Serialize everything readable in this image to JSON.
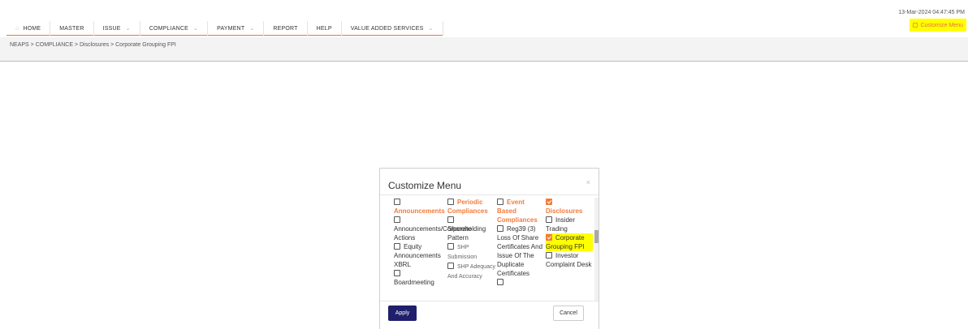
{
  "header": {
    "timestamp": "13-Mar-2024 04:47:45 PM",
    "customize_label": "Customize Menu"
  },
  "nav": {
    "items": [
      {
        "label": "HOME"
      },
      {
        "label": "MASTER"
      },
      {
        "label": "ISSUE"
      },
      {
        "label": "COMPLIANCE"
      },
      {
        "label": "PAYMENT"
      },
      {
        "label": "REPORT"
      },
      {
        "label": "HELP"
      },
      {
        "label": "VALUE ADDED SERVICES"
      }
    ]
  },
  "breadcrumb": "NEAPS > COMPLIANCE > Disclosures > Corporate Grouping FPI",
  "modal": {
    "title": "Customize Menu",
    "close": "×",
    "columns": {
      "announcements": {
        "header": "Announcements",
        "items": [
          "Announcements/Corporate Actions",
          "Equity Announcements XBRL",
          "Boardmeeting"
        ]
      },
      "periodic": {
        "header": "Periodic Compliances",
        "items": [
          "Shareholding Pattern",
          "SHP Submission",
          "SHP Adequacy And Accuracy"
        ]
      },
      "event": {
        "header": "Event Based Compliances",
        "items": [
          "Reg39 (3) Loss Of Share Certificates And Issue Of The Duplicate Certificates"
        ]
      },
      "disclosures": {
        "header": "Disclosures",
        "items": [
          "Insider Trading",
          "Corporate Grouping FPI",
          "Investor Complaint Desk"
        ],
        "checked": [
          false,
          true,
          false
        ]
      }
    },
    "apply_label": "Apply",
    "cancel_label": "Cancel"
  },
  "colors": {
    "accent": "#f47b3a",
    "highlight": "#ffff00",
    "primary_button": "#1f1f6b"
  }
}
